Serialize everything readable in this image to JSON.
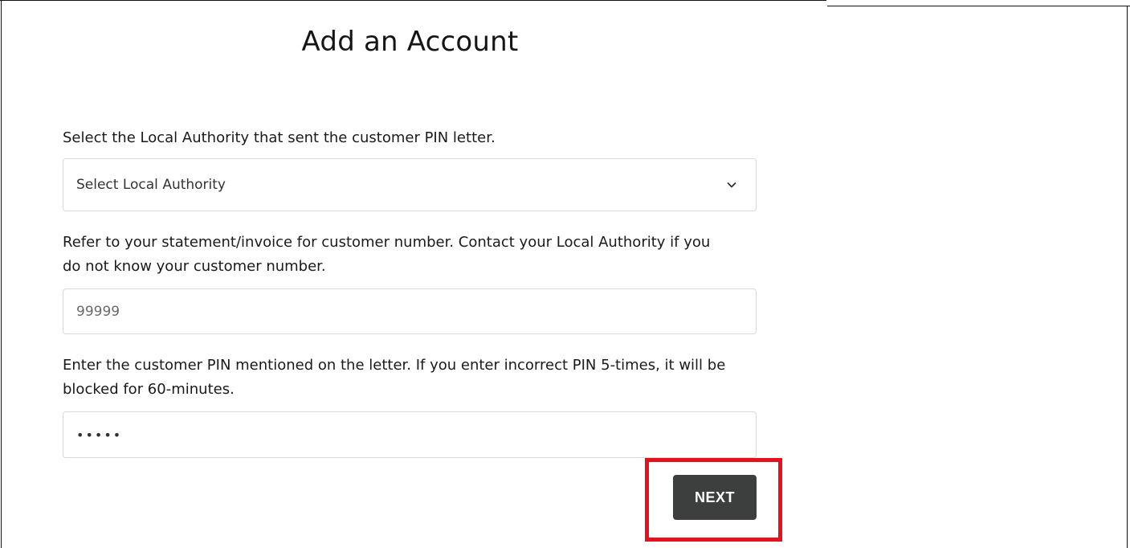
{
  "page": {
    "title": "Add an Account"
  },
  "form": {
    "local_authority": {
      "label": "Select the Local Authority that sent the customer PIN letter.",
      "selected_value": "Select Local Authority",
      "icon": "chevron-down-icon"
    },
    "customer_number": {
      "label": "Refer to your statement/invoice for customer number. Contact your Local Authority if you do not know your customer number.",
      "placeholder": "99999"
    },
    "pin": {
      "label": "Enter the customer PIN mentioned on the letter. If you enter incorrect PIN 5-times, it will be blocked for 60-minutes.",
      "value": "•••••"
    },
    "next_label": "NEXT"
  },
  "colors": {
    "button_bg": "#3c3f3e",
    "highlight": "#e8111b"
  }
}
